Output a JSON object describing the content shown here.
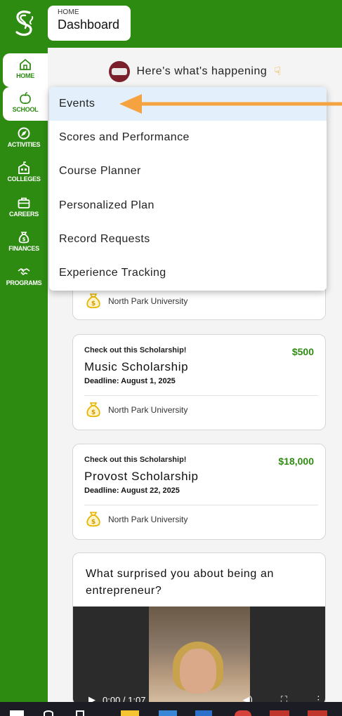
{
  "header": {
    "breadcrumb_small": "HOME",
    "breadcrumb_title": "Dashboard"
  },
  "sidebar": {
    "items": [
      {
        "label": "HOME",
        "icon": "home-icon"
      },
      {
        "label": "SCHOOL",
        "icon": "apple-icon"
      },
      {
        "label": "ACTIVITIES",
        "icon": "compass-icon"
      },
      {
        "label": "COLLEGES",
        "icon": "school-building-icon"
      },
      {
        "label": "CAREERS",
        "icon": "briefcase-icon"
      },
      {
        "label": "FINANCES",
        "icon": "moneybag-icon"
      },
      {
        "label": "PROGRAMS",
        "icon": "handshake-icon"
      }
    ]
  },
  "main": {
    "happening": "Here's what's happening",
    "cards": [
      {
        "org": "North Park University"
      },
      {
        "kicker": "Check out this Scholarship!",
        "amount": "$500",
        "title": "Music Scholarship",
        "deadline": "Deadline: August 1, 2025",
        "org": "North Park University"
      },
      {
        "kicker": "Check out this Scholarship!",
        "amount": "$18,000",
        "title": "Provost Scholarship",
        "deadline": "Deadline: August 22, 2025",
        "org": "North Park University"
      }
    ],
    "video": {
      "question": "What surprised you about being an entrepreneur?",
      "time": "0:00 / 1:07"
    }
  },
  "menu": {
    "items": [
      "Events",
      "Scores and Performance",
      "Course Planner",
      "Personalized Plan",
      "Record Requests",
      "Experience Tracking"
    ]
  },
  "colors": {
    "brand_green": "#2e8b12",
    "arrow_orange": "#f4a340",
    "menu_highlight": "#e3f0fb"
  }
}
